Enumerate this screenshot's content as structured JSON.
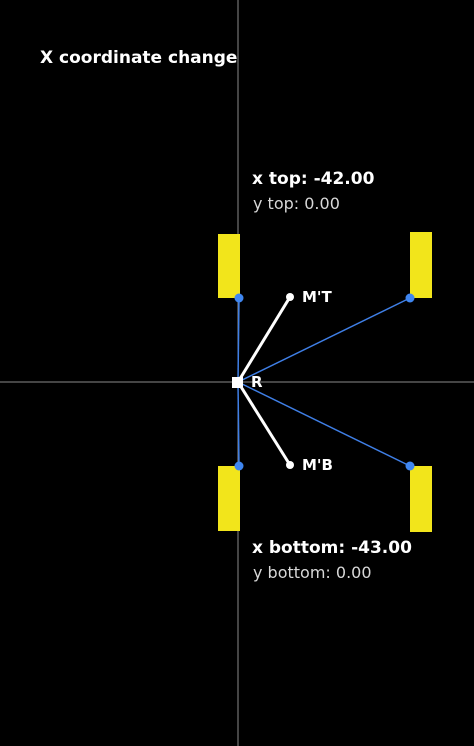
{
  "title": "X coordinate change",
  "top": {
    "x_text": "x top: -42.00",
    "y_text": "y top: 0.00",
    "x": -42.0,
    "y": 0.0
  },
  "bottom": {
    "x_text": "x bottom: -43.00",
    "y_text": "y bottom: 0.00",
    "x": -43.0,
    "y": 0.0
  },
  "labels": {
    "reference": "R",
    "mid_top": "M'T",
    "mid_bottom": "M'B"
  },
  "colors": {
    "background": "#000000",
    "axis": "#8a8a8a",
    "link": "#3f7fe6",
    "joint": "#3f86f0",
    "wheel": "#f2e51b",
    "arm": "#ffffff"
  }
}
